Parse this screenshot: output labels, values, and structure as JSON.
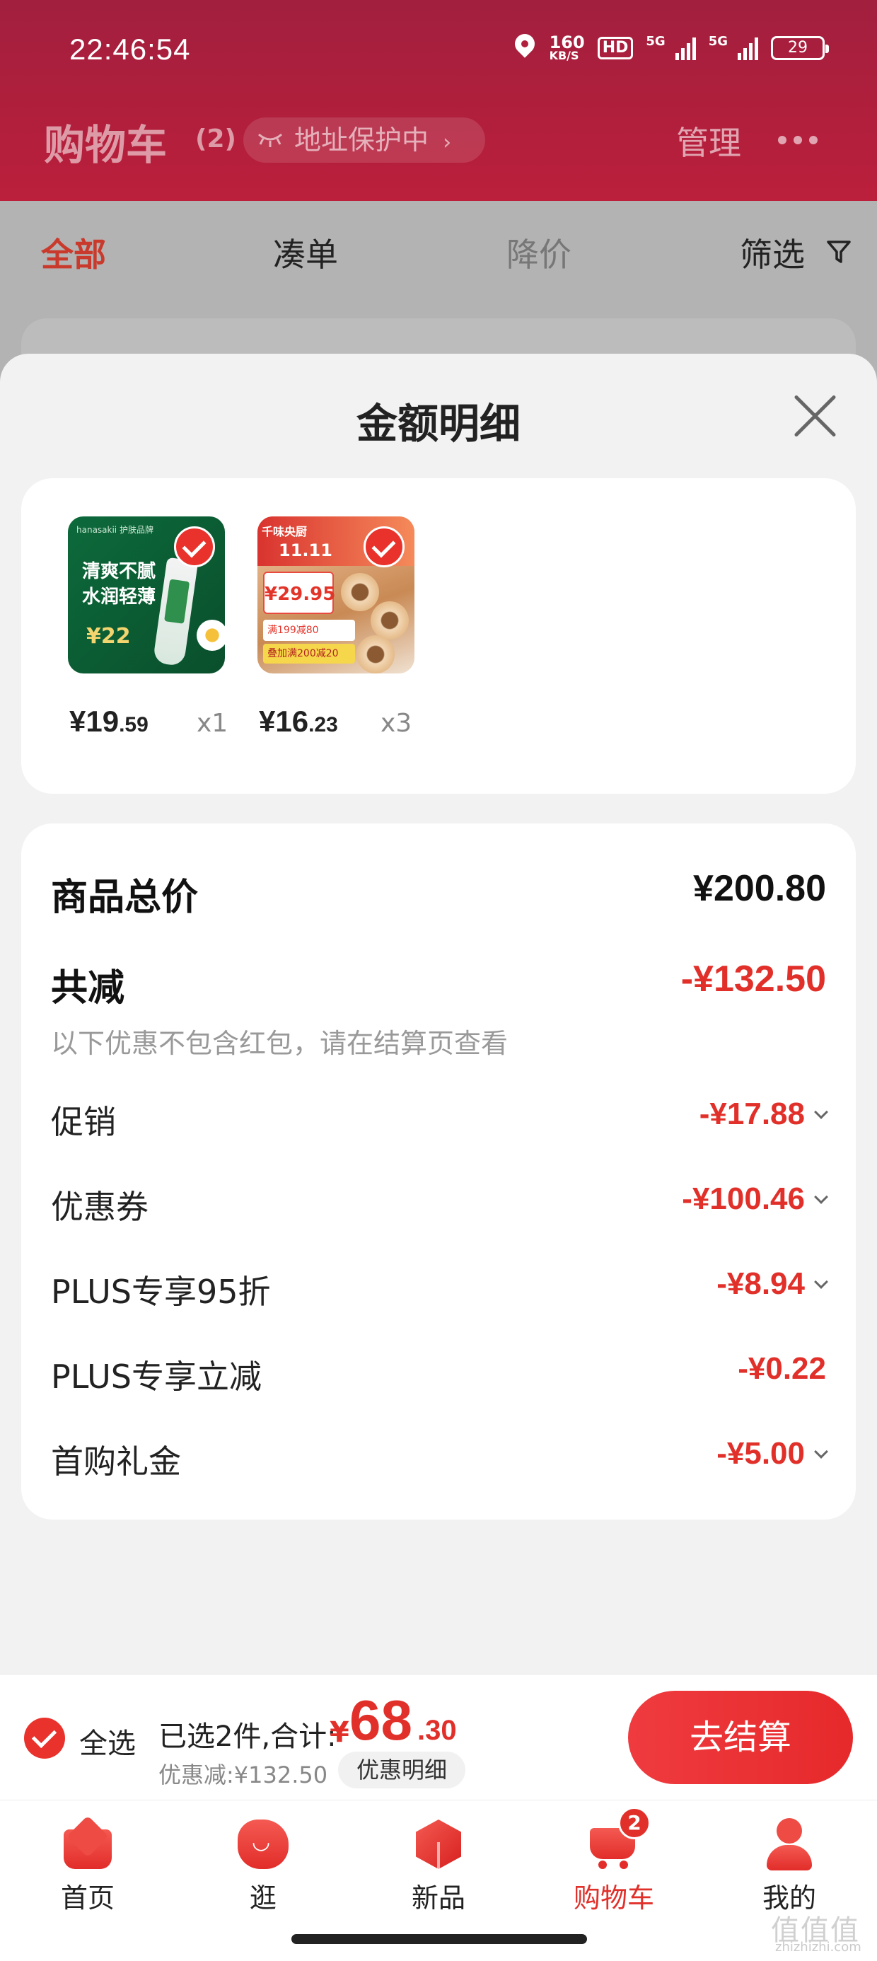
{
  "status_bar": {
    "time": "22:46:54",
    "net_speed": "160",
    "net_unit": "KB/S",
    "hd": "HD",
    "net1": "5G",
    "net2": "5G",
    "battery": "29"
  },
  "header": {
    "title": "购物车",
    "count": "(2)",
    "address_protect": "地址保护中",
    "manage": "管理"
  },
  "filter_tabs": [
    {
      "label": "全部",
      "active": true
    },
    {
      "label": "凑单"
    },
    {
      "label": "降价"
    },
    {
      "label": "筛选"
    }
  ],
  "modal": {
    "title": "金额明细",
    "products": [
      {
        "price_int": "¥19",
        "price_dec": ".59",
        "qty": "x1",
        "image": {
          "logo": "hanasakii 护肤品牌",
          "text_line1": "清爽不腻",
          "text_line2": "水润轻薄",
          "price": "¥22"
        }
      },
      {
        "price_int": "¥16",
        "price_dec": ".23",
        "qty": "x3",
        "image": {
          "badge": "千味央厨",
          "event": "11.11",
          "price": "¥29.95",
          "promo1": "满199减80",
          "promo2": "叠加满200减20"
        }
      }
    ],
    "summary": {
      "total_label": "商品总价",
      "total_value": "¥200.80",
      "reduce_label": "共减",
      "reduce_value": "-¥132.50",
      "note": "以下优惠不包含红包，请在结算页查看",
      "items": [
        {
          "label": "促销",
          "value": "-¥17.88",
          "expandable": true
        },
        {
          "label": "优惠券",
          "value": "-¥100.46",
          "expandable": true
        },
        {
          "label": "PLUS专享95折",
          "value": "-¥8.94",
          "expandable": true
        },
        {
          "label": "PLUS专享立减",
          "value": "-¥0.22",
          "expandable": false
        },
        {
          "label": "首购礼金",
          "value": "-¥5.00",
          "expandable": true
        }
      ]
    }
  },
  "checkout": {
    "select_all": "全选",
    "selected_text": "已选2件,合计:",
    "currency": "¥",
    "total_int": "68",
    "total_dec": ".30",
    "discount_text": "优惠减:¥132.50",
    "detail_button": "优惠明细",
    "checkout_button": "去结算"
  },
  "tabbar": [
    {
      "label": "首页",
      "icon": "home-icon"
    },
    {
      "label": "逛",
      "icon": "stroll-icon"
    },
    {
      "label": "新品",
      "icon": "new-icon"
    },
    {
      "label": "购物车",
      "icon": "cart-icon",
      "active": true,
      "badge": "2"
    },
    {
      "label": "我的",
      "icon": "profile-icon"
    }
  ],
  "watermark": {
    "main": "值值值",
    "sub": "zhizhizhi.com"
  },
  "colors": {
    "brand_red": "#e1302a",
    "header_red": "#b01f3d",
    "background": "#f2f2f2"
  }
}
